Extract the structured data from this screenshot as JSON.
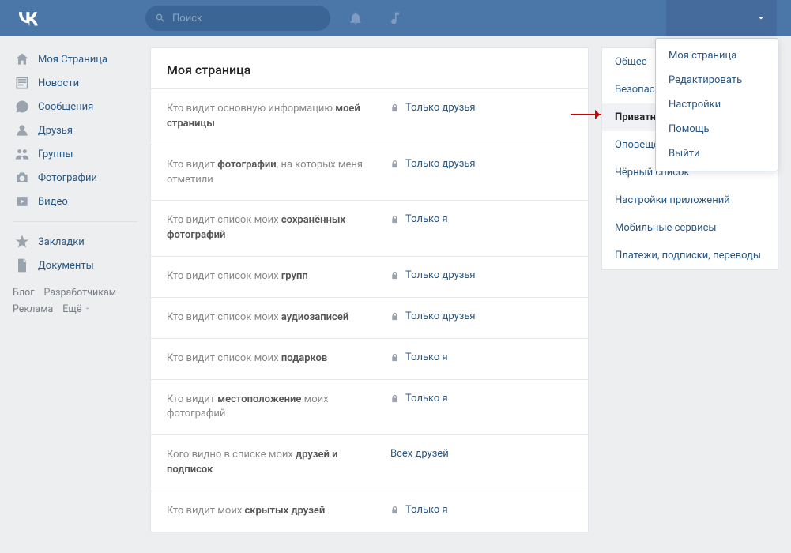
{
  "header": {
    "search_placeholder": "Поиск"
  },
  "leftnav": {
    "items": [
      {
        "label": "Моя Страница"
      },
      {
        "label": "Новости"
      },
      {
        "label": "Сообщения"
      },
      {
        "label": "Друзья"
      },
      {
        "label": "Группы"
      },
      {
        "label": "Фотографии"
      },
      {
        "label": "Видео"
      }
    ],
    "items2": [
      {
        "label": "Закладки"
      },
      {
        "label": "Документы"
      }
    ],
    "footer": [
      "Блог",
      "Разработчикам",
      "Реклама",
      "Ещё"
    ]
  },
  "page_title": "Моя страница",
  "rows": [
    {
      "label_plain": "Кто видит основную информацию ",
      "label_bold": "моей страницы",
      "value": "Только друзья",
      "lock": true
    },
    {
      "label_plain": "Кто видит ",
      "label_bold": "фотографии",
      "label_tail": ", на которых меня отметили",
      "value": "Только друзья",
      "lock": true
    },
    {
      "label_plain": "Кто видит список моих ",
      "label_bold": "сохранённых фотографий",
      "value": "Только я",
      "lock": true
    },
    {
      "label_plain": "Кто видит список моих ",
      "label_bold": "групп",
      "value": "Только друзья",
      "lock": true
    },
    {
      "label_plain": "Кто видит список моих ",
      "label_bold": "аудиозаписей",
      "value": "Только друзья",
      "lock": true
    },
    {
      "label_plain": "Кто видит список моих ",
      "label_bold": "подарков",
      "value": "Только я",
      "lock": true
    },
    {
      "label_plain": "Кто видит ",
      "label_bold": "местоположение",
      "label_tail": " моих фотографий",
      "value": "Только я",
      "lock": true
    },
    {
      "label_plain": "Кого видно в списке моих ",
      "label_bold": "друзей и подписок",
      "value": "Всех друзей",
      "lock": false
    },
    {
      "label_plain": "Кто видит моих ",
      "label_bold": "скрытых друзей",
      "value": "Только я",
      "lock": true
    }
  ],
  "rightnav": {
    "items": [
      "Общее",
      "Безопасность",
      "Приватность",
      "Оповещения",
      "Чёрный список",
      "Настройки приложений",
      "Мобильные сервисы",
      "Платежи, подписки, переводы"
    ],
    "active_index": 2
  },
  "dropdown": {
    "items": [
      "Моя страница",
      "Редактировать",
      "Настройки",
      "Помощь",
      "Выйти"
    ]
  }
}
